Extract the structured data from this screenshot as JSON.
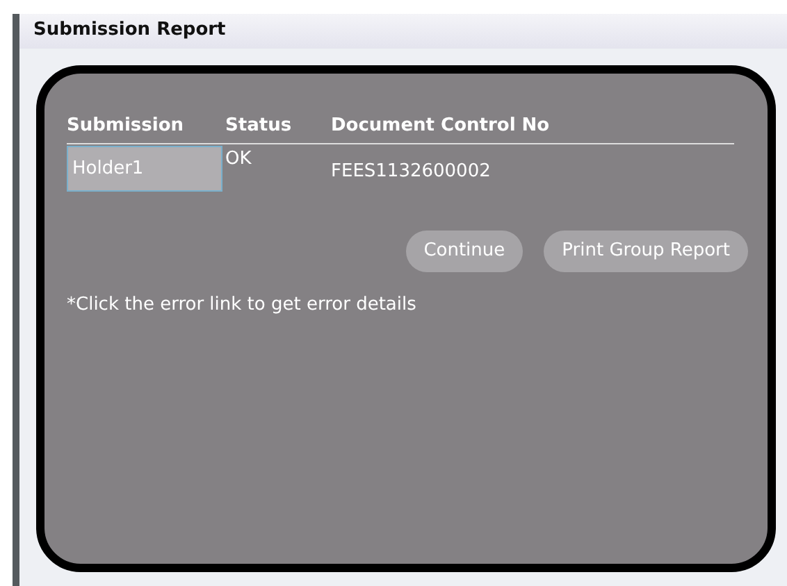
{
  "window": {
    "title": "Submission Report"
  },
  "table": {
    "columns": [
      "Submission",
      "Status",
      "Document Control No"
    ],
    "rows": [
      {
        "submission": "Holder1",
        "selected": true,
        "status": "OK",
        "document_control_no": "FEES1132600002"
      }
    ]
  },
  "buttons": [
    "Continue",
    "Print Group Report"
  ],
  "note": "*Click the error link to get error details"
}
